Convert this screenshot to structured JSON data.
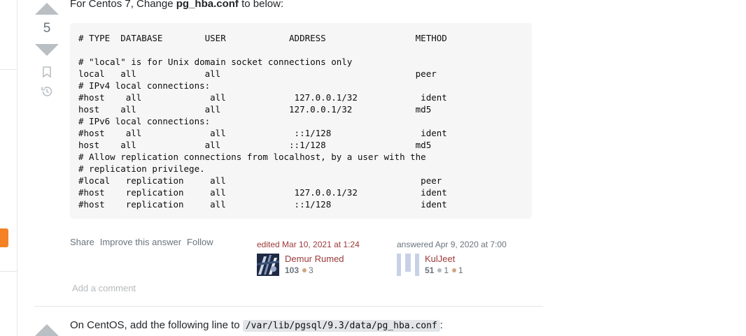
{
  "answer1": {
    "intro_prefix": "For Centos 7, Change ",
    "intro_bold": "pg_hba.conf",
    "intro_suffix": " to below:",
    "votes": "5",
    "code": "# TYPE  DATABASE        USER            ADDRESS                 METHOD\n\n# \"local\" is for Unix domain socket connections only\nlocal   all             all                                     peer\n# IPv4 local connections:\n#host    all             all             127.0.0.1/32            ident\nhost    all             all             127.0.0.1/32            md5\n# IPv6 local connections:\n#host    all             all             ::1/128                 ident\nhost    all             all             ::1/128                 md5\n# Allow replication connections from localhost, by a user with the\n# replication privilege.\n#local   replication     all                                     peer\n#host    replication     all             127.0.0.1/32            ident\n#host    replication     all             ::1/128                 ident",
    "menu": {
      "share": "Share",
      "improve": "Improve this answer",
      "follow": "Follow"
    },
    "edited": {
      "action": "edited Mar 10, 2021 at 1:24",
      "user": "Demur Rumed",
      "rep": "103",
      "bronze": "3"
    },
    "answered": {
      "action": "answered Apr 9, 2020 at 7:00",
      "user": "KulJeet",
      "rep": "51",
      "silver": "1",
      "bronze": "1"
    },
    "add_comment": "Add a comment"
  },
  "answer2": {
    "text_prefix": "On CentOS, add the following line to ",
    "code": "/var/lib/pgsql/9.3/data/pg_hba.conf",
    "text_suffix": ":"
  },
  "colors": {
    "accent_orange": "#f48225",
    "editor_link": "#9b3a38",
    "code_bg": "#f6f6f6"
  },
  "icons": [
    "upvote-arrow-icon",
    "downvote-arrow-icon",
    "bookmark-icon",
    "history-icon"
  ]
}
